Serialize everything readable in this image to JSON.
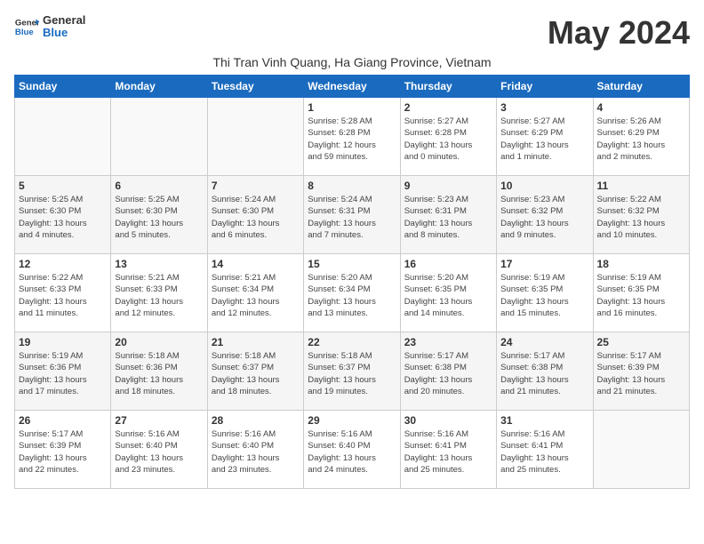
{
  "header": {
    "logo_general": "General",
    "logo_blue": "Blue",
    "month_title": "May 2024",
    "subtitle": "Thi Tran Vinh Quang, Ha Giang Province, Vietnam"
  },
  "weekdays": [
    "Sunday",
    "Monday",
    "Tuesday",
    "Wednesday",
    "Thursday",
    "Friday",
    "Saturday"
  ],
  "weeks": [
    [
      {
        "day": "",
        "info": ""
      },
      {
        "day": "",
        "info": ""
      },
      {
        "day": "",
        "info": ""
      },
      {
        "day": "1",
        "info": "Sunrise: 5:28 AM\nSunset: 6:28 PM\nDaylight: 12 hours\nand 59 minutes."
      },
      {
        "day": "2",
        "info": "Sunrise: 5:27 AM\nSunset: 6:28 PM\nDaylight: 13 hours\nand 0 minutes."
      },
      {
        "day": "3",
        "info": "Sunrise: 5:27 AM\nSunset: 6:29 PM\nDaylight: 13 hours\nand 1 minute."
      },
      {
        "day": "4",
        "info": "Sunrise: 5:26 AM\nSunset: 6:29 PM\nDaylight: 13 hours\nand 2 minutes."
      }
    ],
    [
      {
        "day": "5",
        "info": "Sunrise: 5:25 AM\nSunset: 6:30 PM\nDaylight: 13 hours\nand 4 minutes."
      },
      {
        "day": "6",
        "info": "Sunrise: 5:25 AM\nSunset: 6:30 PM\nDaylight: 13 hours\nand 5 minutes."
      },
      {
        "day": "7",
        "info": "Sunrise: 5:24 AM\nSunset: 6:30 PM\nDaylight: 13 hours\nand 6 minutes."
      },
      {
        "day": "8",
        "info": "Sunrise: 5:24 AM\nSunset: 6:31 PM\nDaylight: 13 hours\nand 7 minutes."
      },
      {
        "day": "9",
        "info": "Sunrise: 5:23 AM\nSunset: 6:31 PM\nDaylight: 13 hours\nand 8 minutes."
      },
      {
        "day": "10",
        "info": "Sunrise: 5:23 AM\nSunset: 6:32 PM\nDaylight: 13 hours\nand 9 minutes."
      },
      {
        "day": "11",
        "info": "Sunrise: 5:22 AM\nSunset: 6:32 PM\nDaylight: 13 hours\nand 10 minutes."
      }
    ],
    [
      {
        "day": "12",
        "info": "Sunrise: 5:22 AM\nSunset: 6:33 PM\nDaylight: 13 hours\nand 11 minutes."
      },
      {
        "day": "13",
        "info": "Sunrise: 5:21 AM\nSunset: 6:33 PM\nDaylight: 13 hours\nand 12 minutes."
      },
      {
        "day": "14",
        "info": "Sunrise: 5:21 AM\nSunset: 6:34 PM\nDaylight: 13 hours\nand 12 minutes."
      },
      {
        "day": "15",
        "info": "Sunrise: 5:20 AM\nSunset: 6:34 PM\nDaylight: 13 hours\nand 13 minutes."
      },
      {
        "day": "16",
        "info": "Sunrise: 5:20 AM\nSunset: 6:35 PM\nDaylight: 13 hours\nand 14 minutes."
      },
      {
        "day": "17",
        "info": "Sunrise: 5:19 AM\nSunset: 6:35 PM\nDaylight: 13 hours\nand 15 minutes."
      },
      {
        "day": "18",
        "info": "Sunrise: 5:19 AM\nSunset: 6:35 PM\nDaylight: 13 hours\nand 16 minutes."
      }
    ],
    [
      {
        "day": "19",
        "info": "Sunrise: 5:19 AM\nSunset: 6:36 PM\nDaylight: 13 hours\nand 17 minutes."
      },
      {
        "day": "20",
        "info": "Sunrise: 5:18 AM\nSunset: 6:36 PM\nDaylight: 13 hours\nand 18 minutes."
      },
      {
        "day": "21",
        "info": "Sunrise: 5:18 AM\nSunset: 6:37 PM\nDaylight: 13 hours\nand 18 minutes."
      },
      {
        "day": "22",
        "info": "Sunrise: 5:18 AM\nSunset: 6:37 PM\nDaylight: 13 hours\nand 19 minutes."
      },
      {
        "day": "23",
        "info": "Sunrise: 5:17 AM\nSunset: 6:38 PM\nDaylight: 13 hours\nand 20 minutes."
      },
      {
        "day": "24",
        "info": "Sunrise: 5:17 AM\nSunset: 6:38 PM\nDaylight: 13 hours\nand 21 minutes."
      },
      {
        "day": "25",
        "info": "Sunrise: 5:17 AM\nSunset: 6:39 PM\nDaylight: 13 hours\nand 21 minutes."
      }
    ],
    [
      {
        "day": "26",
        "info": "Sunrise: 5:17 AM\nSunset: 6:39 PM\nDaylight: 13 hours\nand 22 minutes."
      },
      {
        "day": "27",
        "info": "Sunrise: 5:16 AM\nSunset: 6:40 PM\nDaylight: 13 hours\nand 23 minutes."
      },
      {
        "day": "28",
        "info": "Sunrise: 5:16 AM\nSunset: 6:40 PM\nDaylight: 13 hours\nand 23 minutes."
      },
      {
        "day": "29",
        "info": "Sunrise: 5:16 AM\nSunset: 6:40 PM\nDaylight: 13 hours\nand 24 minutes."
      },
      {
        "day": "30",
        "info": "Sunrise: 5:16 AM\nSunset: 6:41 PM\nDaylight: 13 hours\nand 25 minutes."
      },
      {
        "day": "31",
        "info": "Sunrise: 5:16 AM\nSunset: 6:41 PM\nDaylight: 13 hours\nand 25 minutes."
      },
      {
        "day": "",
        "info": ""
      }
    ]
  ]
}
